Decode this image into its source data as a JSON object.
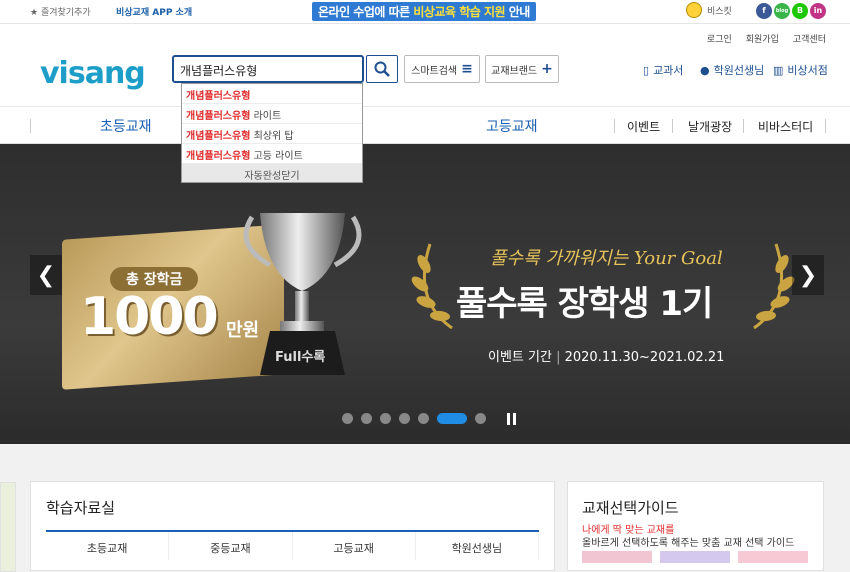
{
  "topbar": {
    "favorite": "즐겨찾기추가",
    "app": "비상교재 APP 소개",
    "banner_pre": "온라인 수업에 따른 ",
    "banner_hl": "비상교육 학습 지원",
    "banner_post": " 안내",
    "bisket": "비스킷",
    "sns": [
      "f",
      "blog",
      "B",
      "in"
    ],
    "sns_colors": [
      "#3b5998",
      "#39b54a",
      "#1ec800",
      "#c13584"
    ]
  },
  "header": {
    "links": [
      "로그인",
      "회원가입",
      "고객센터"
    ],
    "logo": "visang",
    "search_value": "개념플러스유형",
    "smart_search": "스마트검색",
    "brand": "교재브랜드",
    "textbook": "교과서",
    "academy": "학원선생님",
    "store": "비상서점"
  },
  "autocomplete": {
    "items": [
      {
        "match": "개념플러스유형",
        "rest": ""
      },
      {
        "match": "개념플러스유형",
        "rest": " 라이트"
      },
      {
        "match": "개념플러스유형",
        "rest": " 최상위 탑"
      },
      {
        "match": "개념플러스유형",
        "rest": " 고등 라이트"
      }
    ],
    "close": "자동완성닫기"
  },
  "nav": {
    "elementary": "초등교재",
    "high": "고등교재",
    "event": "이벤트",
    "square": "날개광장",
    "study": "비바스터디"
  },
  "hero": {
    "badge": "총 장학금",
    "amount": "1000",
    "unit": "만원",
    "goal": "풀수록 가까워지는 Your Goal",
    "title": "풀수록 장학생 1기",
    "period_label": "이벤트 기간",
    "period": "2020.11.30~2021.02.21",
    "cup_label": "Full수록",
    "slide_count": 7,
    "active_slide": 5
  },
  "study": {
    "title": "학습자료실",
    "tabs": [
      "초등교재",
      "중등교재",
      "고등교재",
      "학원선생님"
    ]
  },
  "guide": {
    "title": "교재선택가이드",
    "tag": "나에게 딱 맞는 교재를",
    "desc": "올바르게 선택하도록 해주는 맞춤 교재 선택 가이드"
  }
}
